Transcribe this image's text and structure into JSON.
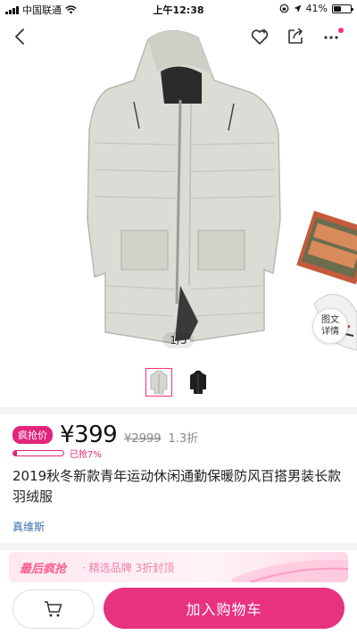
{
  "status_bar": {
    "carrier": "中国联通",
    "time": "上午12:38",
    "battery": "41%"
  },
  "nav": {
    "back_icon": "chevron-left-icon",
    "icons": [
      "heart-plus-icon",
      "share-icon",
      "more-icon"
    ]
  },
  "hero": {
    "counter": "1/5",
    "detail_bubble": {
      "line1": "图文",
      "line2": "详情"
    }
  },
  "thumbnails": [
    {
      "name": "light-coat",
      "active": true
    },
    {
      "name": "black-coat",
      "active": false
    }
  ],
  "price": {
    "tag": "疯抢价",
    "current": "¥399",
    "original": "¥2999",
    "discount": "1.3折",
    "sold_text": "已抢7%",
    "sold_fraction": 0.07
  },
  "product": {
    "title": "2019秋冬新款青年运动休闲通勤保暖防风百搭男装长款羽绒服",
    "brand": "真维斯"
  },
  "promo": {
    "title": "最后疯抢",
    "subtitle": "· 精选品牌  3折封顶"
  },
  "bottom_bar": {
    "add_to_cart": "加入购物车"
  },
  "colors": {
    "accent": "#e7327f",
    "tag": "#e2247c",
    "brand_link": "#3a6fb0"
  }
}
